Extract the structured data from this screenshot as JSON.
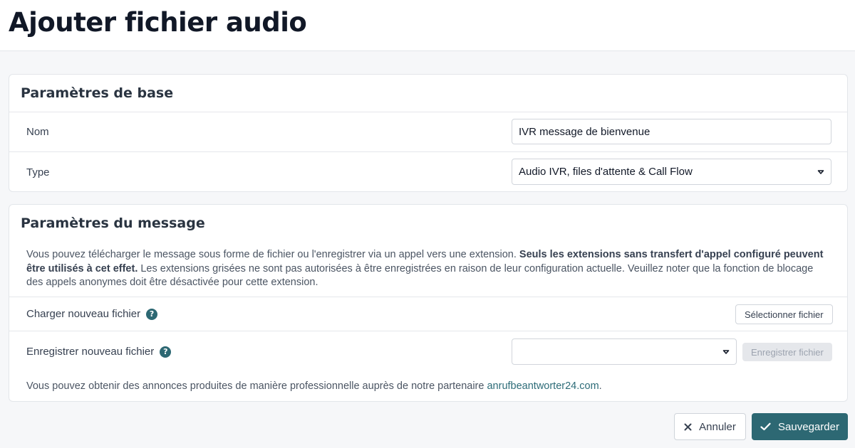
{
  "page": {
    "title": "Ajouter fichier audio"
  },
  "basic_settings": {
    "title": "Paramètres de base",
    "name_label": "Nom",
    "name_value": "IVR message de bienvenue",
    "type_label": "Type",
    "type_value": "Audio IVR, files d'attente & Call Flow"
  },
  "message_settings": {
    "title": "Paramètres du message",
    "desc_part1": "Vous pouvez télécharger le message sous forme de fichier ou l'enregistrer via un appel vers une extension. ",
    "desc_bold": "Seuls les extensions sans transfert d'appel configuré peuvent être utilisés à cet effet.",
    "desc_part2": " Les extensions grisées ne sont pas autorisées à être enregistrées en raison de leur configuration actuelle. Veuillez noter que la fonction de blocage des appels anonymes doit être désactivée pour cette extension.",
    "upload_label": "Charger nouveau fichier",
    "upload_button": "Sélectionner fichier",
    "record_label": "Enregistrer nouveau fichier",
    "record_select_value": "",
    "record_button": "Enregistrer fichier",
    "help_glyph": "?",
    "footnote_text": "Vous pouvez obtenir des annonces produites de manière professionnelle auprès de notre partenaire ",
    "footnote_link": "anrufbeantworter24.com",
    "footnote_end": "."
  },
  "actions": {
    "cancel_label": "Annuler",
    "save_label": "Sauvegarder"
  },
  "icons": {
    "help": "question-circle-icon",
    "chevron": "chevron-down-icon",
    "cancel": "close-icon",
    "save": "check-icon"
  },
  "colors": {
    "accent": "#2d6873",
    "link": "#2d6c78"
  }
}
